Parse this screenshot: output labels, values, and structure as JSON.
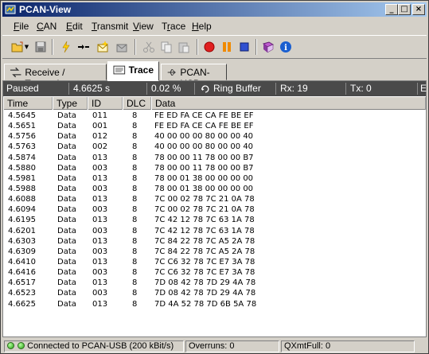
{
  "window": {
    "title": "PCAN-View",
    "minimize": "_",
    "maximize": "□",
    "close": "×"
  },
  "menu": [
    "File",
    "CAN",
    "Edit",
    "Transmit",
    "View",
    "Trace",
    "Help"
  ],
  "menu_underline": [
    "F",
    "C",
    "E",
    "T",
    "V",
    "r",
    "H"
  ],
  "toolbar": {
    "icons": [
      "open-folder-icon",
      "save-disk-icon",
      "connect-lightning-icon",
      "disconnect-icon",
      "new-message-icon",
      "edit-message-icon",
      "cut-icon",
      "copy-icon",
      "paste-icon",
      "record-icon",
      "pause-icon",
      "stop-icon",
      "book-icon",
      "info-icon"
    ]
  },
  "tabs": [
    {
      "label": "Receive / Transmit",
      "active": false,
      "icon": "receive-transmit-icon"
    },
    {
      "label": "Trace",
      "active": true,
      "icon": "trace-icon"
    },
    {
      "label": "PCAN-USB",
      "active": false,
      "icon": "usb-icon"
    }
  ],
  "trace_status": {
    "state": "Paused",
    "time": "4.6625 s",
    "fill": "0.02 %",
    "mode": "Ring Buffer",
    "rx": "Rx: 19",
    "tx": "Tx: 0",
    "errors": "E"
  },
  "columns": [
    "Time",
    "Type",
    "ID",
    "DLC",
    "Data"
  ],
  "rows": [
    [
      "4.5645",
      "Data",
      "011",
      "8",
      "FE ED FA CE CA FE BE EF"
    ],
    [
      "4.5651",
      "Data",
      "001",
      "8",
      "FE ED FA CE CA FE BE EF"
    ],
    [
      "4.5756",
      "Data",
      "012",
      "8",
      "40 00 00 00 80 00 00 40"
    ],
    [
      "4.5763",
      "Data",
      "002",
      "8",
      "40 00 00 00 80 00 00 40"
    ],
    [
      "4.5874",
      "Data",
      "013",
      "8",
      "78 00 00 11 78 00 00 B7"
    ],
    [
      "4.5880",
      "Data",
      "003",
      "8",
      "78 00 00 11 78 00 00 B7"
    ],
    [
      "4.5981",
      "Data",
      "013",
      "8",
      "78 00 01 38 00 00 00 00"
    ],
    [
      "4.5988",
      "Data",
      "003",
      "8",
      "78 00 01 38 00 00 00 00"
    ],
    [
      "4.6088",
      "Data",
      "013",
      "8",
      "7C 00 02 78 7C 21 0A 78"
    ],
    [
      "4.6094",
      "Data",
      "003",
      "8",
      "7C 00 02 78 7C 21 0A 78"
    ],
    [
      "4.6195",
      "Data",
      "013",
      "8",
      "7C 42 12 78 7C 63 1A 78"
    ],
    [
      "4.6201",
      "Data",
      "003",
      "8",
      "7C 42 12 78 7C 63 1A 78"
    ],
    [
      "4.6303",
      "Data",
      "013",
      "8",
      "7C 84 22 78 7C A5 2A 78"
    ],
    [
      "4.6309",
      "Data",
      "003",
      "8",
      "7C 84 22 78 7C A5 2A 78"
    ],
    [
      "4.6410",
      "Data",
      "013",
      "8",
      "7C C6 32 78 7C E7 3A 78"
    ],
    [
      "4.6416",
      "Data",
      "003",
      "8",
      "7C C6 32 78 7C E7 3A 78"
    ],
    [
      "4.6517",
      "Data",
      "013",
      "8",
      "7D 08 42 78 7D 29 4A 78"
    ],
    [
      "4.6523",
      "Data",
      "003",
      "8",
      "7D 08 42 78 7D 29 4A 78"
    ],
    [
      "4.6625",
      "Data",
      "013",
      "8",
      "7D 4A 52 78 7D 6B 5A 78"
    ]
  ],
  "statusbar": {
    "connection": "Connected to PCAN-USB (200 kBit/s)",
    "overruns": "Overruns: 0",
    "qxmtfull": "QXmtFull: 0"
  },
  "colors": {
    "title_start": "#0a246a",
    "title_end": "#a6caf0",
    "strip_bg": "#4a4a4a",
    "led": "#22a010"
  }
}
